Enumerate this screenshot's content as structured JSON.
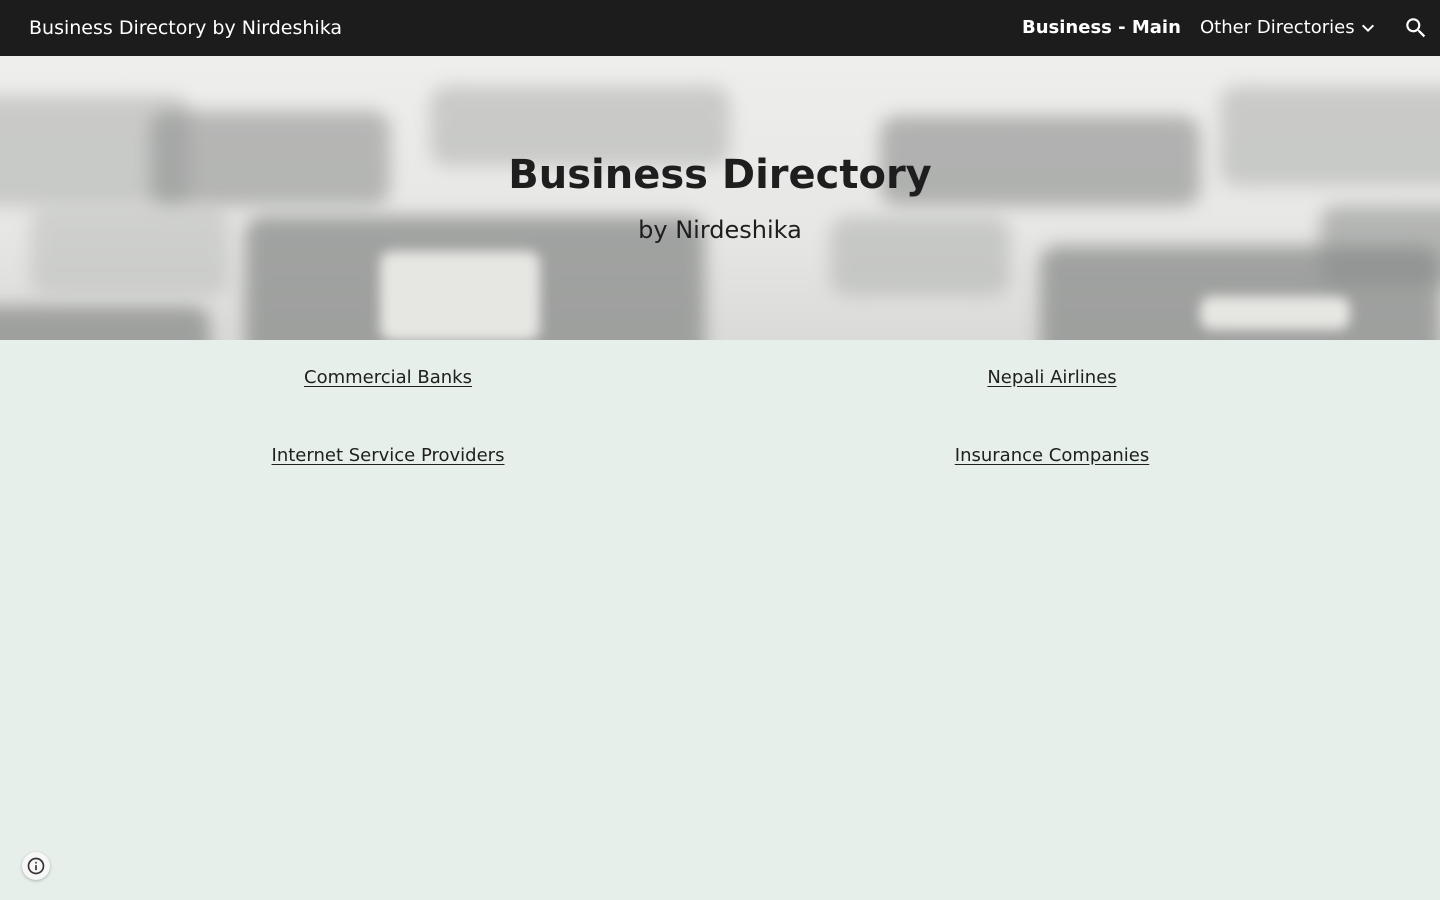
{
  "header": {
    "site_title": "Business Directory by Nirdeshika",
    "nav": {
      "main": "Business - Main",
      "other": "Other Directories"
    },
    "icons": {
      "dropdown": "chevron-down-icon",
      "search": "search-icon"
    }
  },
  "hero": {
    "title": "Business Directory",
    "subtitle": "by Nirdeshika"
  },
  "links": {
    "left": [
      "Commercial Banks",
      "Internet Service Providers"
    ],
    "right": [
      "Nepali Airlines",
      "Insurance Companies"
    ]
  },
  "footer": {
    "info_icon": "info-icon"
  },
  "colors": {
    "header_bg": "#1c1c1c",
    "page_bg": "#e6efea",
    "text_dark": "#1e1e1e"
  }
}
